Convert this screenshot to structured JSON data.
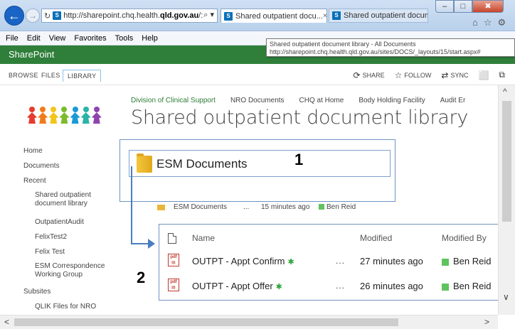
{
  "browser": {
    "url_prefix": "http://sharepoint.chq.health.",
    "url_bold": "qld.gov.au",
    "url_suffix": "/:",
    "search_icon": "⌕ ▾",
    "reload_icon": "↻",
    "favicon": "S",
    "tabs": [
      {
        "label": "Shared outpatient docu...",
        "close": "×"
      },
      {
        "label": "Shared outpatient documen..."
      }
    ],
    "window_controls": {
      "minimize": "–",
      "maximize": "□",
      "close": "✖"
    },
    "toolbar_icons": [
      "home-icon",
      "star-icon",
      "gear-icon"
    ],
    "toolbar_glyphs": [
      "⌂",
      "☆",
      "⚙"
    ]
  },
  "menubar": [
    "File",
    "Edit",
    "View",
    "Favorites",
    "Tools",
    "Help"
  ],
  "tooltip": {
    "line1": "Shared outpatient document library - All Documents",
    "line2": "http://sharepoint.chq.health.qld.gov.au/sites/DOCS/_layouts/15/start.aspx#"
  },
  "suitebar": {
    "title": "SharePoint"
  },
  "ribbon": {
    "tabs": [
      "BROWSE",
      "FILES",
      "LIBRARY"
    ],
    "actions": [
      {
        "label": "SHARE",
        "icon": "⟳"
      },
      {
        "label": "FOLLOW",
        "icon": "☆"
      },
      {
        "label": "SYNC",
        "icon": "⇄"
      }
    ],
    "focus_icon": "⬜",
    "extra_icon": "⧉"
  },
  "topnav": [
    "Division of Clinical Support",
    "NRO Documents",
    "CHQ at Home",
    "Body Holding Facility",
    "Audit Er"
  ],
  "page_title": "Shared outpatient document library",
  "logo_colors": [
    "#e63b2e",
    "#f07d1a",
    "#f3c51b",
    "#7dbb2d",
    "#1a9ad6",
    "#2ab3a6",
    "#8e44ad"
  ],
  "leftnav": {
    "home": "Home",
    "documents": "Documents",
    "recent": "Recent",
    "recent_items": [
      "Shared outpatient",
      "document library",
      "OutpatientAudit",
      "FelixTest2",
      "Felix Test",
      "ESM Correspondence",
      "Working Group"
    ],
    "subsites": "Subsites",
    "subsite_items": [
      "QLIK Files for NRO"
    ]
  },
  "callout1": {
    "number": "1",
    "folder_label": "ESM Documents"
  },
  "folder_row": {
    "name": "ESM Documents",
    "dots": "...",
    "modified": "15 minutes ago",
    "author": "Ben Reid"
  },
  "callout2": {
    "number": "2",
    "headers": {
      "name": "Name",
      "modified": "Modified",
      "modified_by": "Modified By"
    },
    "files": [
      {
        "name": "OUTPT - Appt Confirm",
        "new": "✱",
        "dots": "...",
        "modified": "27 minutes ago",
        "author": "Ben Reid",
        "icon": "pdf"
      },
      {
        "name": "OUTPT - Appt Offer",
        "new": "✱",
        "dots": "...",
        "modified": "26 minutes ago",
        "author": "Ben Reid",
        "icon": "pdf"
      }
    ]
  },
  "colors": {
    "suitebar": "#2f7f3a",
    "presence": "#5ec35e",
    "accent_blue": "#4a7ec0",
    "link_green": "#2a7d34"
  },
  "scroll_glyphs": {
    "up": "^",
    "down": "∨",
    "left": "<",
    "right": ">"
  }
}
